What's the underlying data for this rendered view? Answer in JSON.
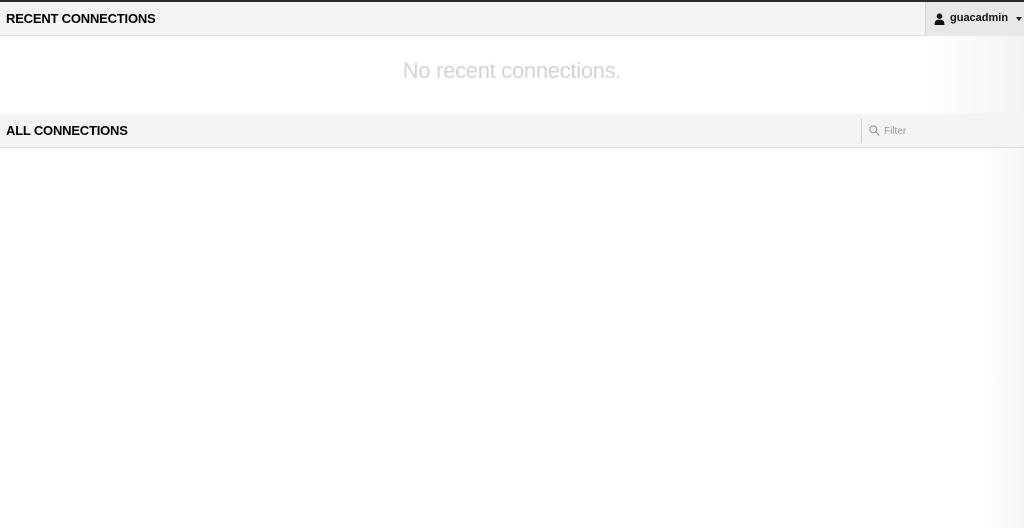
{
  "recent": {
    "title": "RECENT CONNECTIONS",
    "empty_message": "No recent connections."
  },
  "user_menu": {
    "username": "guacadmin",
    "icon": "user-icon",
    "dropdown_icon": "caret-down-icon"
  },
  "all": {
    "title": "ALL CONNECTIONS",
    "filter": {
      "placeholder": "Filter",
      "value": "",
      "icon": "search-icon"
    }
  }
}
